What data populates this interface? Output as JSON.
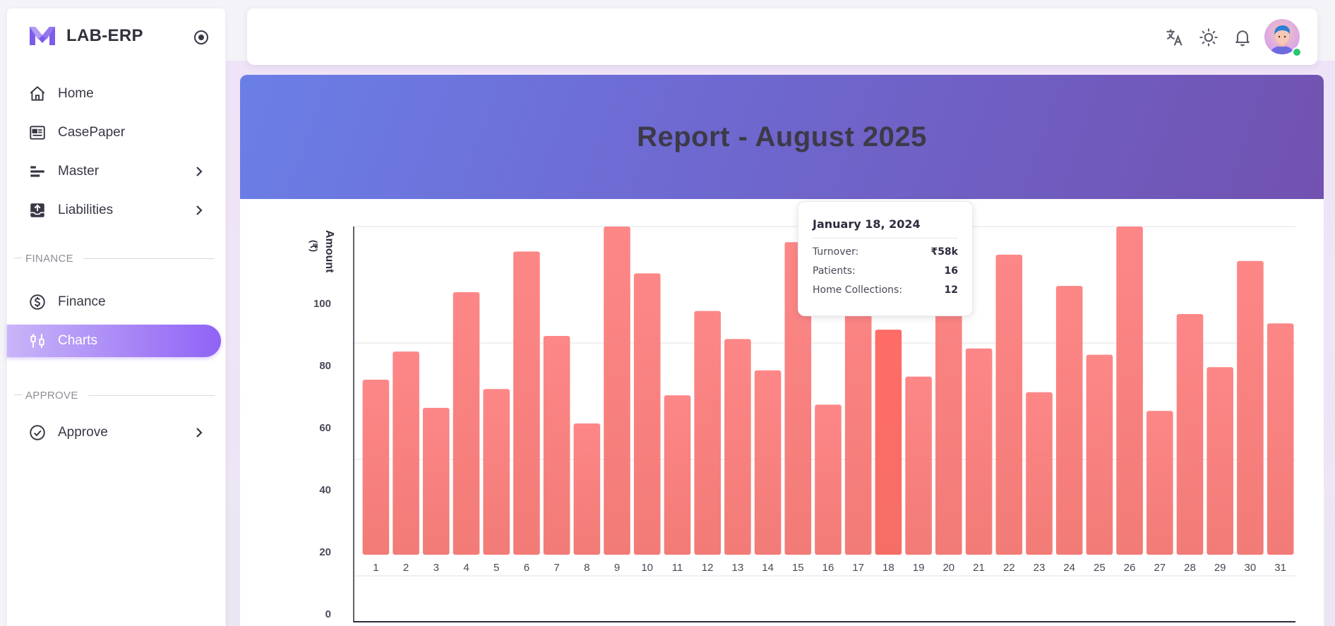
{
  "app": {
    "name": "LAB-ERP"
  },
  "sidebar": {
    "items": [
      {
        "label": "Home",
        "icon": "home-icon"
      },
      {
        "label": "CasePaper",
        "icon": "newspaper-icon"
      },
      {
        "label": "Master",
        "icon": "align-left-icon",
        "has_children": true
      },
      {
        "label": "Liabilities",
        "icon": "inbox-upload-icon",
        "has_children": true
      }
    ],
    "sections": [
      {
        "title": "FINANCE",
        "items": [
          {
            "label": "Finance",
            "icon": "dollar-circle-icon"
          },
          {
            "label": "Charts",
            "icon": "adjustments-icon",
            "active": true
          }
        ]
      },
      {
        "title": "APPROVE",
        "items": [
          {
            "label": "Approve",
            "icon": "check-circle-icon",
            "has_children": true
          }
        ]
      }
    ]
  },
  "topbar": {
    "icons": [
      "translate-icon",
      "sun-icon",
      "bell-icon"
    ],
    "user_status_color": "#28c76f"
  },
  "report": {
    "title": "Report - August 2025"
  },
  "tooltip": {
    "date": "January 18, 2024",
    "rows": [
      {
        "label": "Turnover:",
        "value": "₹58k"
      },
      {
        "label": "Patients:",
        "value": "16"
      },
      {
        "label": "Home Collections:",
        "value": "12"
      }
    ]
  },
  "colors": {
    "accent": "#8f63f5",
    "bar": "#f88080",
    "bar_highlight": "#ff6660",
    "banner_start": "#6a7fe6",
    "banner_end": "#7152b0"
  },
  "chart_data": {
    "type": "bar",
    "ylabel": "Amount (₹)",
    "xlabel": "",
    "categories": [
      "1",
      "2",
      "3",
      "4",
      "5",
      "6",
      "7",
      "8",
      "9",
      "10",
      "11",
      "12",
      "13",
      "14",
      "15",
      "16",
      "17",
      "18",
      "19",
      "20",
      "21",
      "22",
      "23",
      "24",
      "25",
      "26",
      "27",
      "28",
      "29",
      "30",
      "31"
    ],
    "values": [
      76,
      85,
      67,
      104,
      73,
      117,
      90,
      62,
      125,
      110,
      71,
      98,
      89,
      79,
      120,
      68,
      120,
      92,
      77,
      125,
      86,
      116,
      72,
      106,
      84,
      125,
      66,
      97,
      80,
      114,
      94
    ],
    "highlight_index": 17,
    "yticks": [
      0,
      20,
      40,
      60,
      80,
      100
    ],
    "ylim": [
      5,
      125
    ],
    "grid": true
  }
}
